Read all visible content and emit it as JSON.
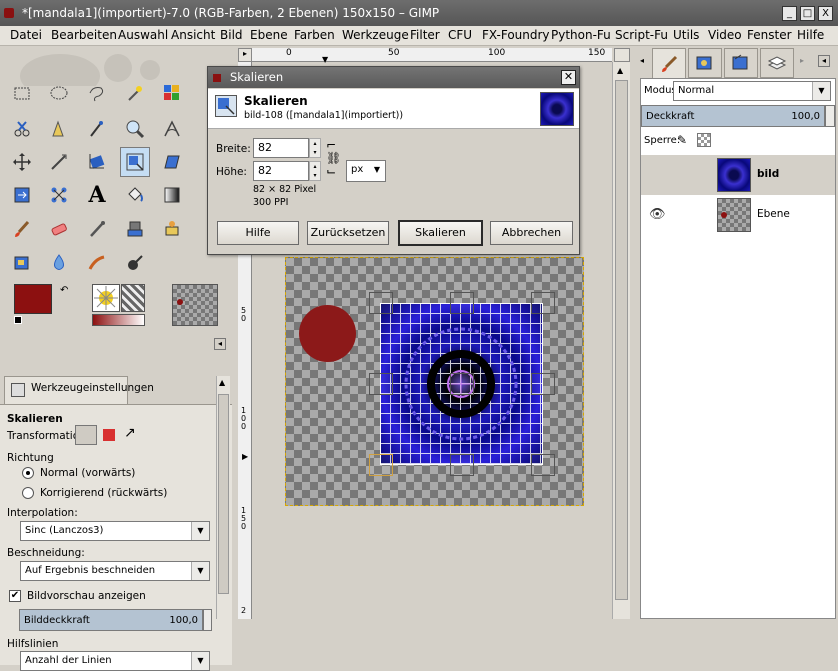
{
  "window": {
    "title": "*[mandala1](importiert)-7.0 (RGB-Farben, 2 Ebenen) 150x150 – GIMP",
    "min": "_",
    "max": "□",
    "close": "X"
  },
  "menu": [
    "Datei",
    "Bearbeiten",
    "Auswahl",
    "Ansicht",
    "Bild",
    "Ebene",
    "Farben",
    "Werkzeuge",
    "Filter",
    "CFU",
    "FX-Foundry",
    "Python-Fu",
    "Script-Fu",
    "Utils",
    "Video",
    "Fenster",
    "Hilfe"
  ],
  "ruler": {
    "h": [
      "0",
      "50",
      "100",
      "150"
    ],
    "v": [
      "5\n0",
      "1\n0\n0",
      "1\n5\n0",
      "2"
    ]
  },
  "toolbox": {
    "tab_label": "Werkzeugeinstellungen",
    "tool_title": "Skalieren",
    "transformation_label": "Transformation:",
    "richtung_label": "Richtung",
    "radio_normal": "Normal (vorwärts)",
    "radio_korrigierend": "Korrigierend (rückwärts)",
    "interpolation_label": "Interpolation:",
    "interpolation_value": "Sinc (Lanczos3)",
    "beschneidung_label": "Beschneidung:",
    "beschneidung_value": "Auf Ergebnis beschneiden",
    "preview_label": "Bildvorschau anzeigen",
    "opacity_label": "Bilddeckkraft",
    "opacity_value": "100,0",
    "guides_label": "Hilfslinien",
    "guides_value": "Anzahl der Linien",
    "fg_color": "#8c1010",
    "bg_color": "#ffffff"
  },
  "dialog": {
    "title": "Skalieren",
    "header_title": "Skalieren",
    "header_sub": "bild-108 ([mandala1](importiert))",
    "width_label": "Breite:",
    "width_value": "82",
    "height_label": "Höhe:",
    "height_value": "82",
    "size_info": "82 × 82 Pixel",
    "resolution": "300 PPI",
    "unit": "px",
    "btn_help": "Hilfe",
    "btn_reset": "Zurücksetzen",
    "btn_scale": "Skalieren",
    "btn_cancel": "Abbrechen"
  },
  "layers": {
    "mode_label": "Modus:",
    "mode_value": "Normal",
    "opacity_label": "Deckkraft",
    "opacity_value": "100,0",
    "lock_label": "Sperre:",
    "items": [
      {
        "name": "bild"
      },
      {
        "name": "Ebene"
      }
    ]
  }
}
